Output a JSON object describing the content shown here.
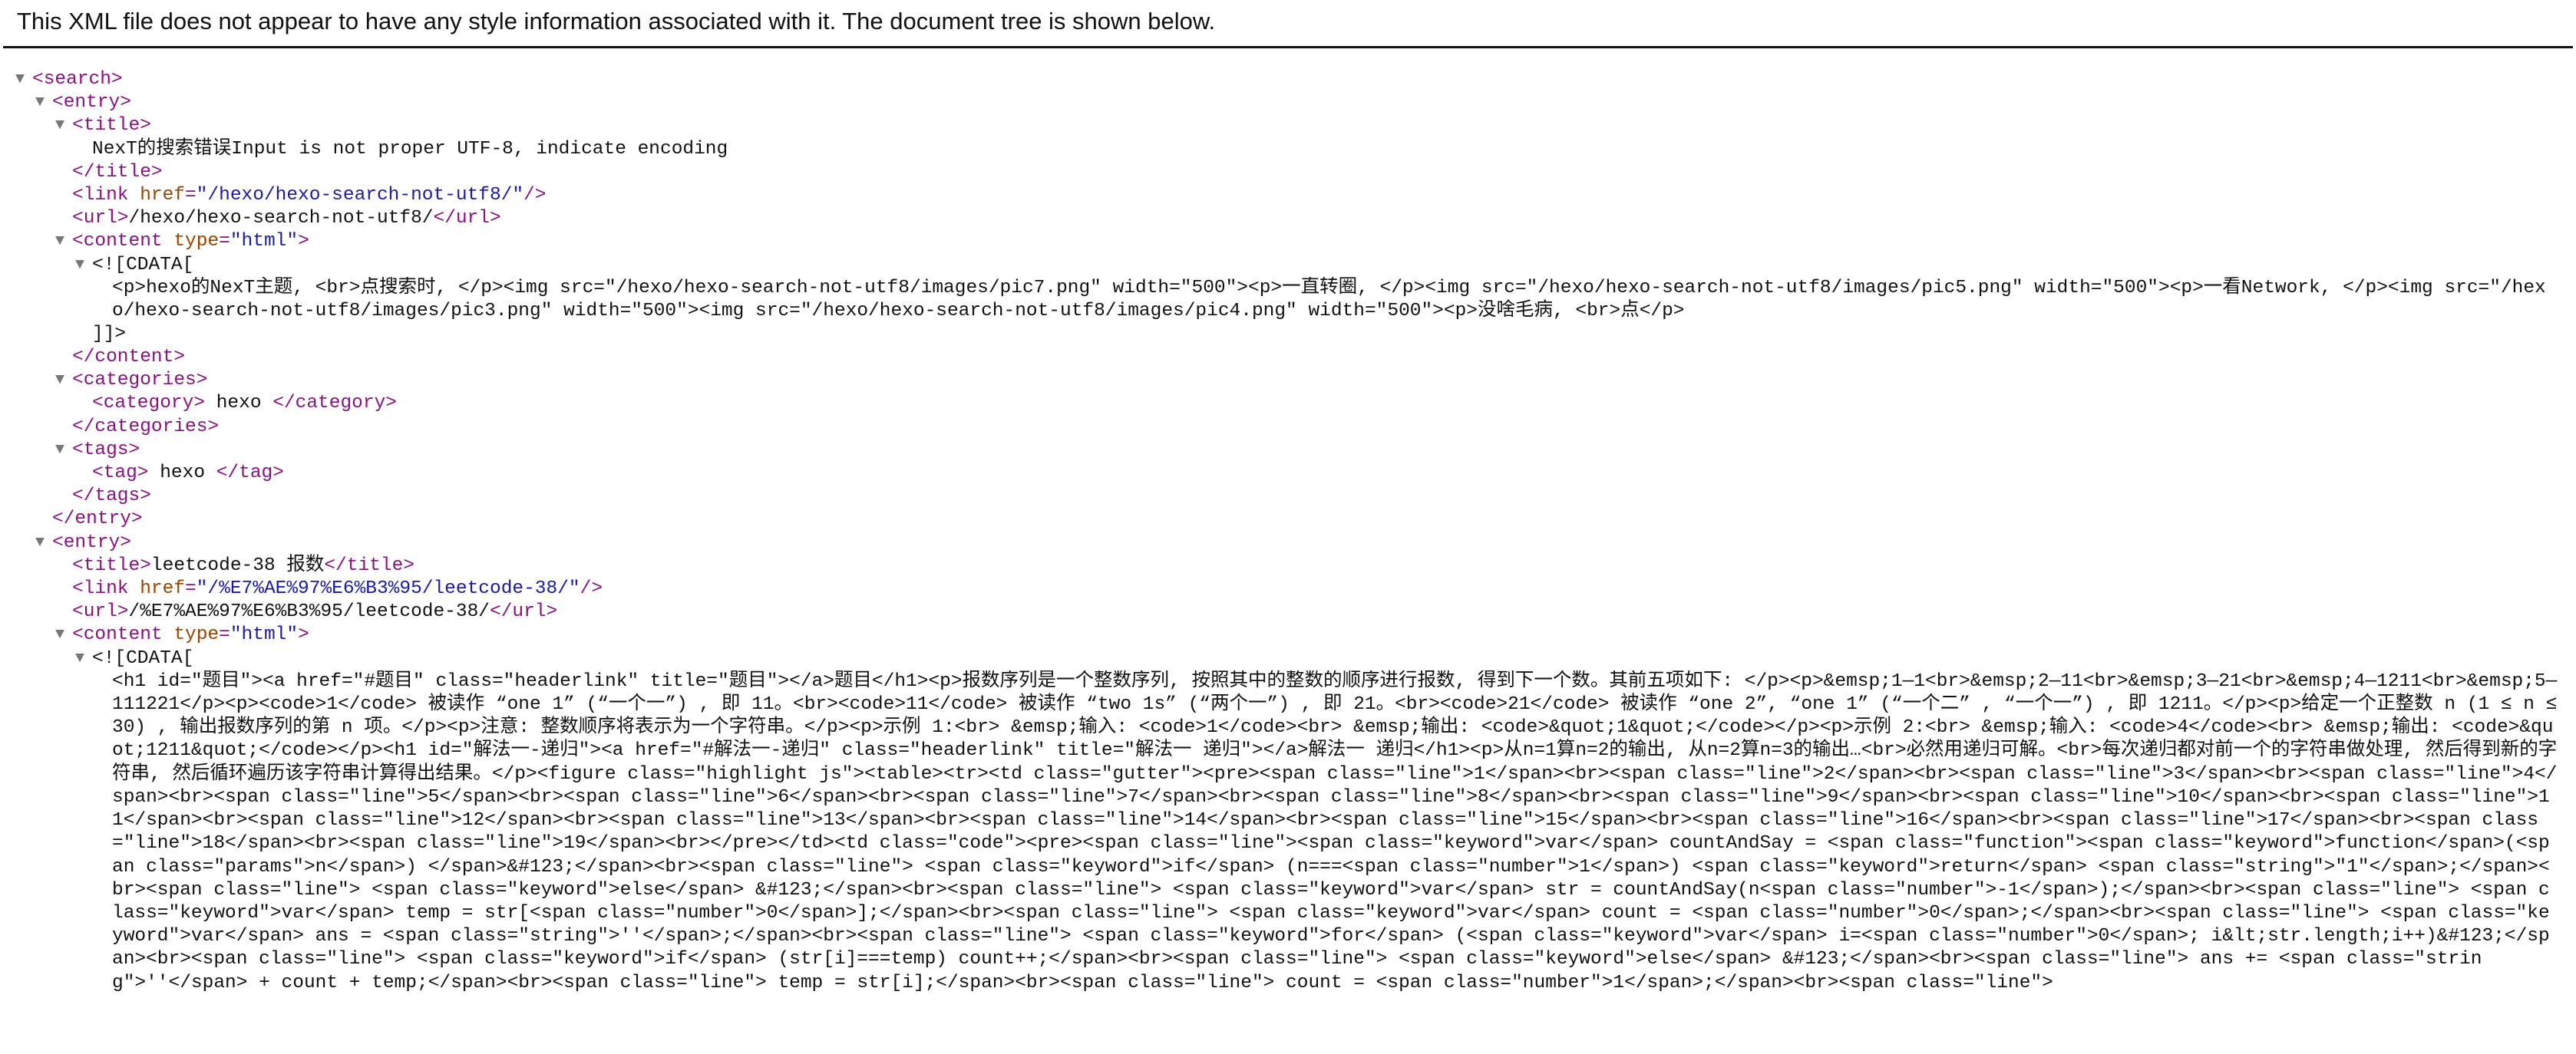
{
  "info_banner": "This XML file does not appear to have any style information associated with it. The document tree is shown below.",
  "entry1": {
    "title": "NexT的搜索错误Input is not proper UTF-8, indicate encoding",
    "link_href": "\"/hexo/hexo-search-not-utf8/\"",
    "url": "/hexo/hexo-search-not-utf8/",
    "content_type": "\"html\"",
    "cdata_open": "<![CDATA[",
    "cdata_body": "<p>hexo的NexT主题, <br>点搜索时, </p><img src=\"/hexo/hexo-search-not-utf8/images/pic7.png\" width=\"500\"><p>一直转圈, </p><img src=\"/hexo/hexo-search-not-utf8/images/pic5.png\" width=\"500\"><p>一看Network, </p><img src=\"/hexo/hexo-search-not-utf8/images/pic3.png\" width=\"500\"><img src=\"/hexo/hexo-search-not-utf8/images/pic4.png\" width=\"500\"><p>没啥毛病, <br>点</p>",
    "cdata_close": "]]>",
    "category": " hexo ",
    "tag": " hexo "
  },
  "entry2": {
    "title": "leetcode-38 报数",
    "link_href": "\"/%E7%AE%97%E6%B3%95/leetcode-38/\"",
    "url": "/%E7%AE%97%E6%B3%95/leetcode-38/",
    "content_type": "\"html\"",
    "cdata_open": "<![CDATA[",
    "cdata_body": "<h1 id=\"题目\"><a href=\"#题目\" class=\"headerlink\" title=\"题目\"></a>题目</h1><p>报数序列是一个整数序列, 按照其中的整数的顺序进行报数, 得到下一个数。其前五项如下: </p><p>&emsp;1—1<br>&emsp;2—11<br>&emsp;3—21<br>&emsp;4—1211<br>&emsp;5—111221</p><p><code>1</code> 被读作 “one 1” (“一个一”) , 即 11。<br><code>11</code> 被读作 “two 1s” (“两个一”) , 即 21。<br><code>21</code> 被读作 “one 2”, “one 1” (“一个二” , “一个一”) , 即 1211。</p><p>给定一个正整数 n (1 ≤ n ≤ 30) , 输出报数序列的第 n 项。</p><p>注意: 整数顺序将表示为一个字符串。</p><p>示例 1:<br> &emsp;输入: <code>1</code><br> &emsp;输出: <code>&quot;1&quot;</code></p><p>示例 2:<br> &emsp;输入: <code>4</code><br> &emsp;输出: <code>&quot;1211&quot;</code></p><h1 id=\"解法一-递归\"><a href=\"#解法一-递归\" class=\"headerlink\" title=\"解法一 递归\"></a>解法一 递归</h1><p>从n=1算n=2的输出, 从n=2算n=3的输出…<br>必然用递归可解。<br>每次递归都对前一个的字符串做处理, 然后得到新的字符串, 然后循环遍历该字符串计算得出结果。</p><figure class=\"highlight js\"><table><tr><td class=\"gutter\"><pre><span class=\"line\">1</span><br><span class=\"line\">2</span><br><span class=\"line\">3</span><br><span class=\"line\">4</span><br><span class=\"line\">5</span><br><span class=\"line\">6</span><br><span class=\"line\">7</span><br><span class=\"line\">8</span><br><span class=\"line\">9</span><br><span class=\"line\">10</span><br><span class=\"line\">11</span><br><span class=\"line\">12</span><br><span class=\"line\">13</span><br><span class=\"line\">14</span><br><span class=\"line\">15</span><br><span class=\"line\">16</span><br><span class=\"line\">17</span><br><span class=\"line\">18</span><br><span class=\"line\">19</span><br></pre></td><td class=\"code\"><pre><span class=\"line\"><span class=\"keyword\">var</span> countAndSay = <span class=\"function\"><span class=\"keyword\">function</span>(<span class=\"params\">n</span>) </span>&#123;</span><br><span class=\"line\"> <span class=\"keyword\">if</span> (n===<span class=\"number\">1</span>) <span class=\"keyword\">return</span> <span class=\"string\">\"1\"</span>;</span><br><span class=\"line\"> <span class=\"keyword\">else</span> &#123;</span><br><span class=\"line\"> <span class=\"keyword\">var</span> str = countAndSay(n<span class=\"number\">-1</span>);</span><br><span class=\"line\"> <span class=\"keyword\">var</span> temp = str[<span class=\"number\">0</span>];</span><br><span class=\"line\"> <span class=\"keyword\">var</span> count = <span class=\"number\">0</span>;</span><br><span class=\"line\"> <span class=\"keyword\">var</span> ans = <span class=\"string\">''</span>;</span><br><span class=\"line\"> <span class=\"keyword\">for</span> (<span class=\"keyword\">var</span> i=<span class=\"number\">0</span>; i&lt;str.length;i++)&#123;</span><br><span class=\"line\"> <span class=\"keyword\">if</span> (str[i]===temp) count++;</span><br><span class=\"line\"> <span class=\"keyword\">else</span> &#123;</span><br><span class=\"line\"> ans += <span class=\"string\">''</span> + count + temp;</span><br><span class=\"line\"> temp = str[i];</span><br><span class=\"line\"> count = <span class=\"number\">1</span>;</span><br><span class=\"line\">"
  },
  "icons": {
    "expanded": "▼"
  }
}
